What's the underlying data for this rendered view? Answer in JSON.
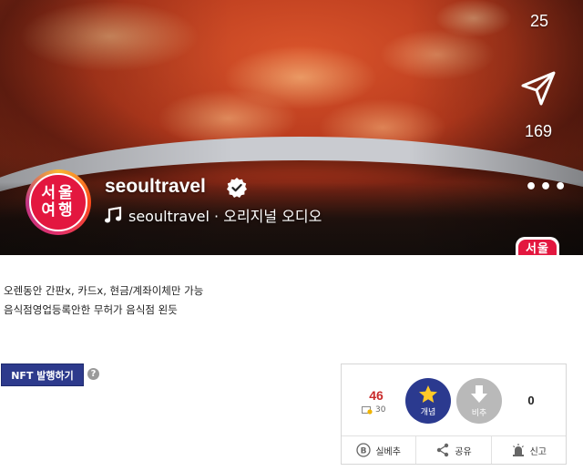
{
  "media": {
    "like_count": "25",
    "share_count": "169",
    "channel": {
      "avatar_line1": "서울",
      "avatar_line2": "여행",
      "username": "seoultravel",
      "audio_label": "seoultravel · 오리지널 오디오"
    },
    "mini_badge": "서울",
    "icons": {
      "share": "send-icon",
      "more": "more-dots-icon",
      "verified": "verified-badge-icon",
      "music": "music-note-icon"
    }
  },
  "post": {
    "line1": "오렌동안 간판x, 카드x, 현금/계좌이체만 가능",
    "line2": "음식점영업등록안한 무허가 음식점 왼듯"
  },
  "nft": {
    "button_label": "NFT 발행하기",
    "help": "?"
  },
  "vote": {
    "up_count": "46",
    "sub_count": "30",
    "up_label": "개념",
    "down_label": "비추",
    "down_count": "0",
    "actions": {
      "report_best": "실베추",
      "share": "공유",
      "report": "신고"
    }
  },
  "colors": {
    "nft_button": "#2d3a8c",
    "up_button": "#2b3a8f",
    "down_button": "#b9b9b9",
    "up_count": "#c92a2a",
    "avatar": "#e3173f"
  }
}
